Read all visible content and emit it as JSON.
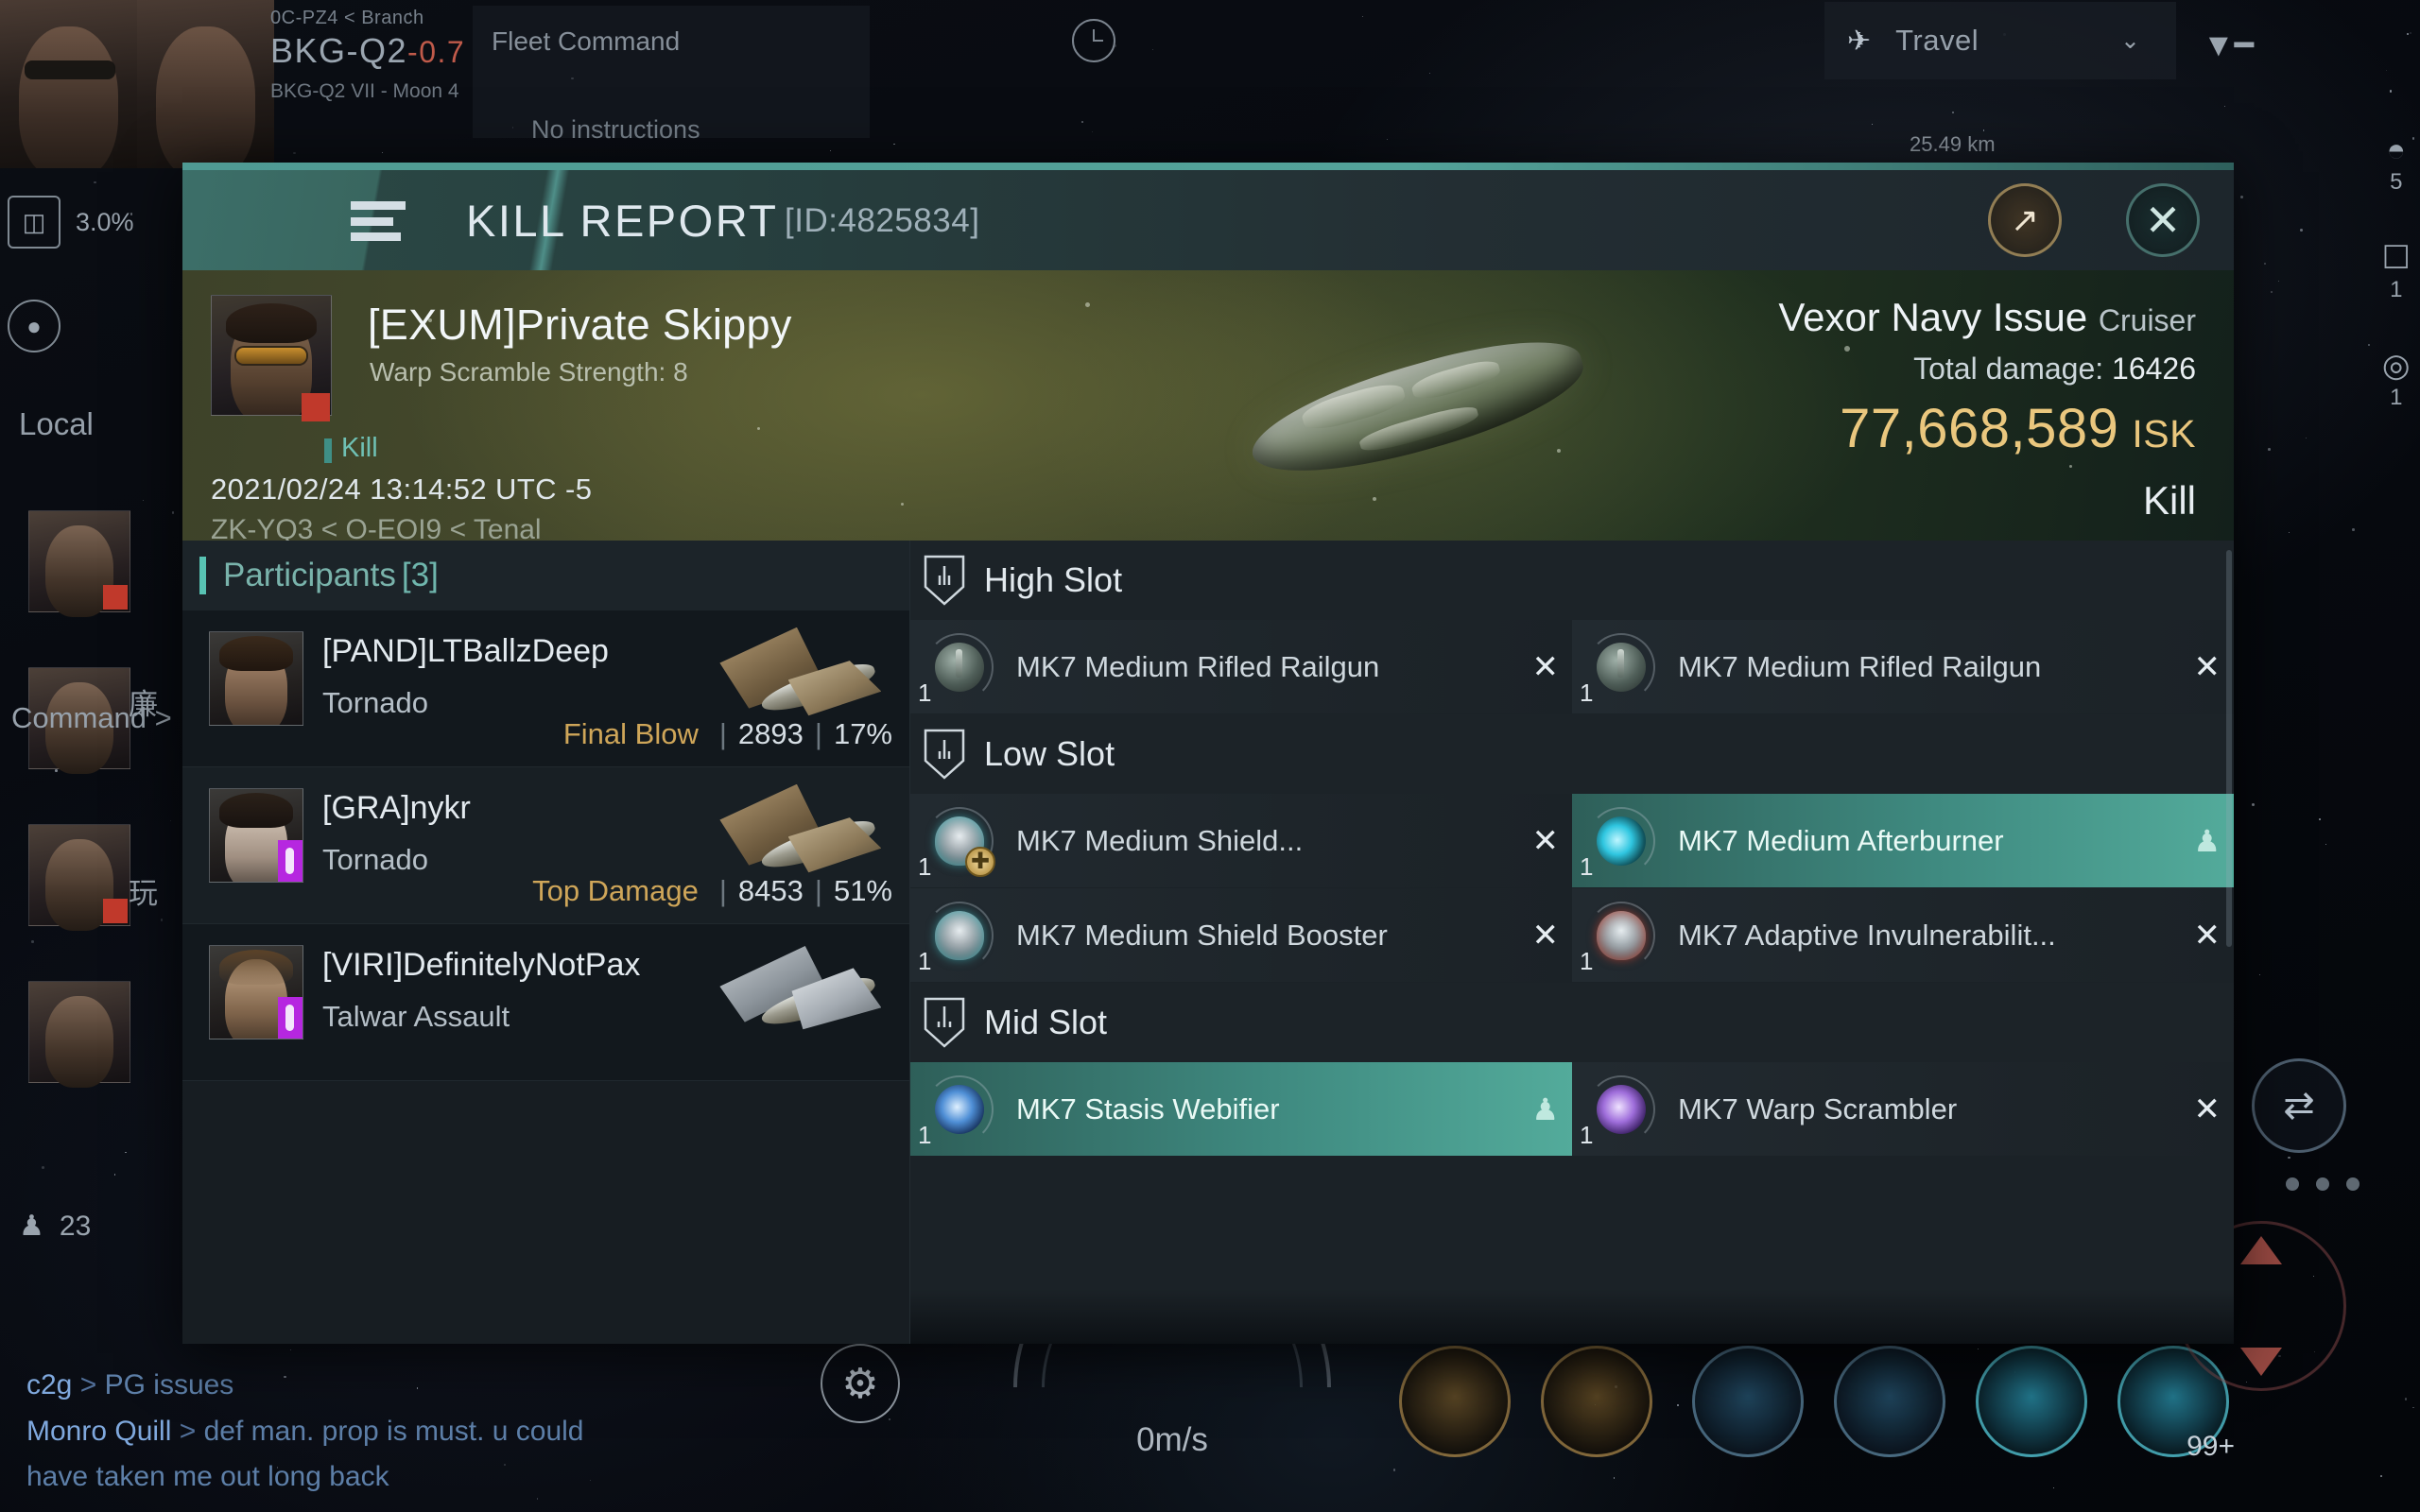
{
  "background": {
    "location": {
      "region_route": "0C-PZ4  < Branch",
      "system": "BKG-Q2",
      "security": "-0.7",
      "celestial": "BKG-Q2 VII - Moon 4"
    },
    "fleet": {
      "title": "Fleet Command",
      "status": "No instructions",
      "clock_icon": "clock-icon"
    },
    "travel": {
      "label": "Travel",
      "chevron": "⌄",
      "ship_icon": "ship-icon",
      "filter_icon": "filter-icon"
    },
    "left_rail": [
      {
        "icon": "cargo-icon",
        "label": "3.0%"
      },
      {
        "icon": "location-pin-icon",
        "label": ""
      },
      {
        "icon": "home-icon",
        "label": "Local"
      }
    ],
    "command_label": "Command",
    "command_chevron": ">",
    "cjk_1": "廉",
    "cjk_2": "玩",
    "pilot_count": "23",
    "right_numbers": {
      "distance": "25.49",
      "unit": "km",
      "extra": "1"
    },
    "right_icons": [
      {
        "icon": "signal-icon",
        "value": "5"
      },
      {
        "icon": "frame-icon",
        "value": "1"
      },
      {
        "icon": "target-icon",
        "value": "1"
      }
    ],
    "chat": [
      {
        "name": "c2g",
        "arrow": ">",
        "message": "PG issues"
      },
      {
        "name": "Monro Quill",
        "arrow": ">",
        "message": "def man. prop is must. u could"
      },
      {
        "name": "",
        "arrow": "",
        "message": "have taken me out long back"
      }
    ],
    "hud": {
      "speed": "0m/s",
      "gear_icon": "gear-icon",
      "swap_icon": "swap-icon",
      "badge": "99+"
    }
  },
  "window": {
    "menu_icon": "hamburger-menu-icon",
    "title": "KILL REPORT",
    "report_id": "[ID:4825834]",
    "share_icon": "external-link-icon",
    "close_icon": "close-icon",
    "accent_color": "#53a39a"
  },
  "victim": {
    "portrait": "victim-portrait",
    "name": "[EXUM]Private Skippy",
    "subtitle": "Warp Scramble Strength: 8",
    "status_label": "Kill",
    "timestamp": "2021/02/24 13:14:52 UTC -5",
    "location_path": "ZK-YQ3 < O-EOI9 < Tenal",
    "ship_name": "Vexor Navy Issue",
    "ship_class": "Cruiser",
    "total_damage_label": "Total damage:",
    "total_damage_value": "16426",
    "isk_value": "77,668,589",
    "isk_unit": "ISK",
    "verdict": "Kill",
    "isk_color": "#eac77e"
  },
  "participants": {
    "header_label": "Participants",
    "header_count": "[3]",
    "rows": [
      {
        "name": "[PAND]LTBallzDeep",
        "ship": "Tornado",
        "tag": "Final Blow",
        "damage": "2893",
        "percent": "17%",
        "sep": "|"
      },
      {
        "name": "[GRA]nykr",
        "ship": "Tornado",
        "tag": "Top Damage",
        "damage": "8453",
        "percent": "51%",
        "sep": "|"
      },
      {
        "name": "[VIRI]DefinitelyNotPax",
        "ship": "Talwar Assault",
        "tag": "",
        "damage": "",
        "percent": "",
        "sep": ""
      }
    ]
  },
  "fitting": {
    "sections": [
      {
        "title": "High Slot",
        "icon": "slot-shield-icon",
        "modules": [
          {
            "name": "MK7 Medium Rifled Railgun",
            "qty": "1",
            "overlay": "drop-x",
            "selected": false,
            "icon": "railgun-icon"
          },
          {
            "name": "MK7 Medium Rifled Railgun",
            "qty": "1",
            "overlay": "drop-x",
            "selected": false,
            "icon": "railgun-icon"
          }
        ]
      },
      {
        "title": "Low Slot",
        "icon": "slot-shield-icon",
        "modules": [
          {
            "name": "MK7 Medium Shield...",
            "qty": "1",
            "overlay": "drop-x",
            "selected": false,
            "icon": "shield-booster-icon"
          },
          {
            "name": "MK7 Medium Afterburner",
            "qty": "1",
            "overlay": "looted-person",
            "selected": true,
            "icon": "afterburner-icon"
          },
          {
            "name": "MK7 Medium Shield Booster",
            "qty": "1",
            "overlay": "drop-x",
            "selected": false,
            "icon": "shield-booster-icon"
          },
          {
            "name": "MK7 Adaptive Invulnerabilit...",
            "qty": "1",
            "overlay": "drop-x",
            "selected": false,
            "icon": "invulnerability-field-icon"
          }
        ]
      },
      {
        "title": "Mid Slot",
        "icon": "slot-shield-icon",
        "modules": [
          {
            "name": "MK7 Stasis Webifier",
            "qty": "1",
            "overlay": "looted-person",
            "selected": true,
            "icon": "stasis-webifier-icon"
          },
          {
            "name": "MK7 Warp Scrambler",
            "qty": "1",
            "overlay": "drop-x",
            "selected": false,
            "icon": "warp-scrambler-icon"
          }
        ]
      }
    ]
  }
}
